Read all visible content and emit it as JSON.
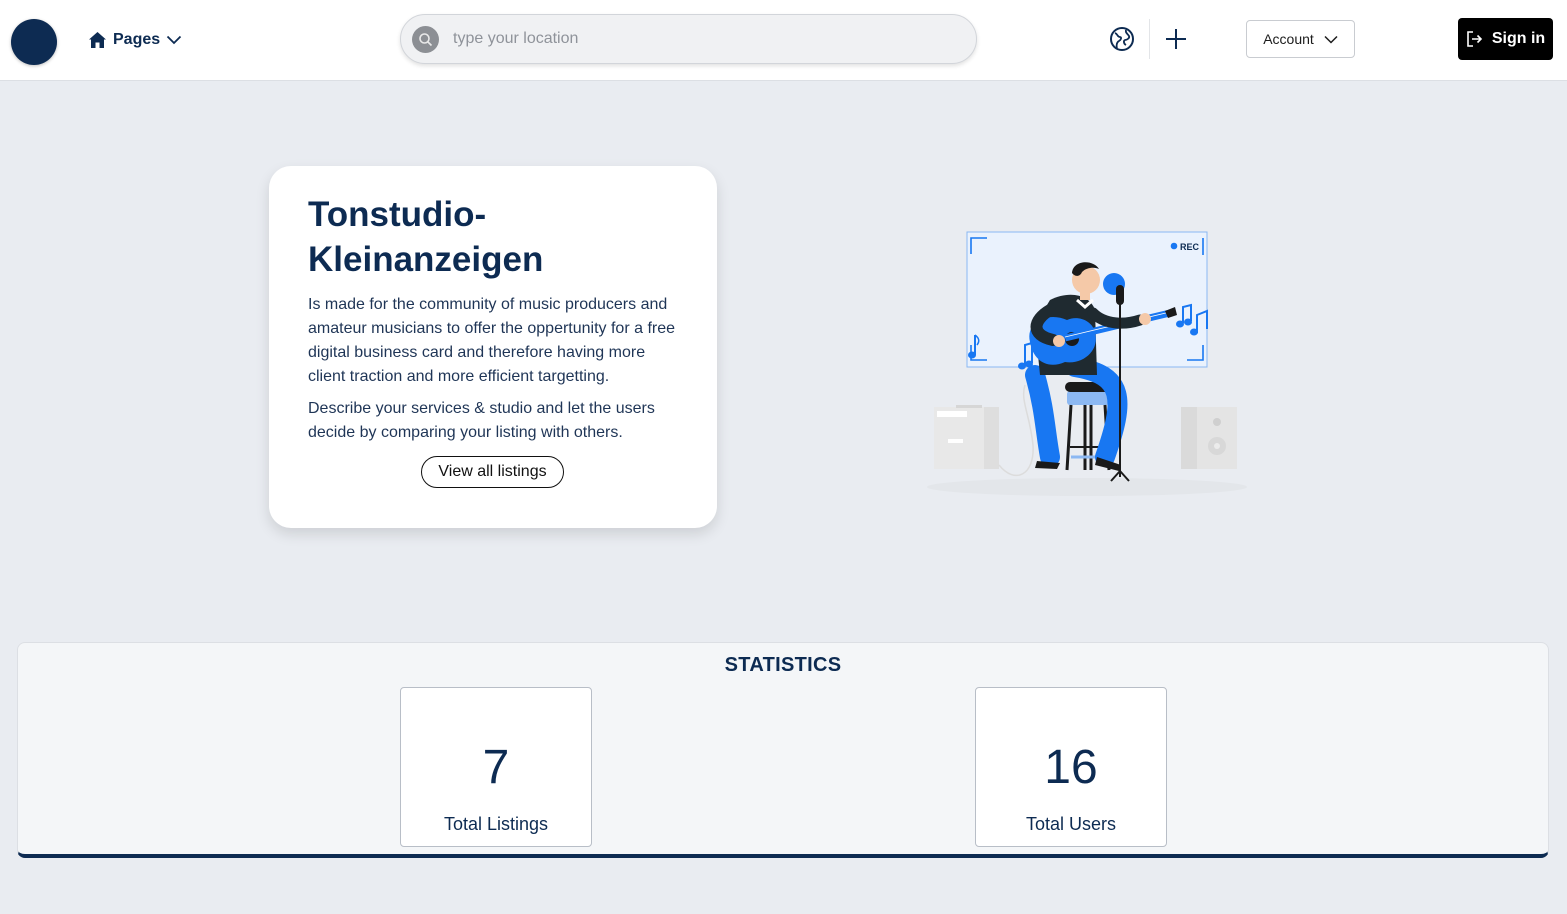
{
  "header": {
    "nav_label": "Pages",
    "search_placeholder": "type your location",
    "account_label": "Account",
    "signin_label": "Sign in"
  },
  "hero": {
    "title": "Tonstudio-Kleinanzeigen",
    "paragraph1": "Is made for the community of music producers and amateur musicians to offer the oppertunity for a free digital business card and therefore having more client traction and more efficient targetting.",
    "paragraph2": "Describe your services & studio and let the users decide by comparing your listing with others.",
    "button_label": "View all listings"
  },
  "illustration": {
    "rec_label": "REC"
  },
  "statistics": {
    "title": "STATISTICS",
    "cards": [
      {
        "value": "7",
        "label": "Total Listings"
      },
      {
        "value": "16",
        "label": "Total Users"
      }
    ]
  },
  "colors": {
    "brand_navy": "#0d2b52",
    "accent_blue": "#1877f2",
    "background": "#e9ecf1"
  }
}
